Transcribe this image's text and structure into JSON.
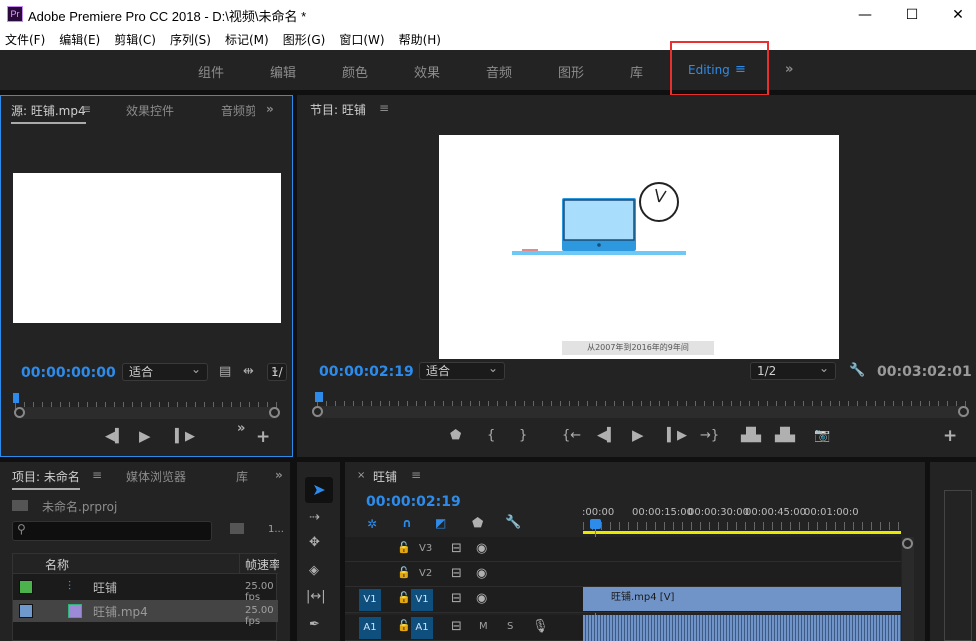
{
  "window": {
    "title": "Adobe Premiere Pro CC 2018 - D:\\视频\\未命名 *",
    "logo": "Pr",
    "minimize": "—",
    "maximize": "☐",
    "close": "✕"
  },
  "menu": [
    "文件(F)",
    "编辑(E)",
    "剪辑(C)",
    "序列(S)",
    "标记(M)",
    "图形(G)",
    "窗口(W)",
    "帮助(H)"
  ],
  "workspaces": {
    "items": [
      "组件",
      "编辑",
      "颜色",
      "效果",
      "音频",
      "图形",
      "库"
    ],
    "active": "Editing",
    "more": "»"
  },
  "source": {
    "tabs": [
      "源: 旺铺.mp4",
      "效果控件",
      "音频剪"
    ],
    "timecode": "00:00:00:00",
    "zoom": "适合",
    "resolution": "1/"
  },
  "program": {
    "tab": "节目: 旺铺",
    "timecode": "00:00:02:19",
    "zoom": "适合",
    "resolution": "1/2",
    "duration": "00:03:02:01",
    "caption": "从2007年到2016年的9年间"
  },
  "project": {
    "tabs": [
      "项目: 未命名",
      "媒体浏览器",
      "库"
    ],
    "file": "未命名.prproj",
    "count": "1...",
    "columns": [
      "名称",
      "帧速率"
    ],
    "items": [
      {
        "name": "旺铺",
        "fps": "25.00 fps",
        "color": "#4cb34c",
        "selected": false
      },
      {
        "name": "旺铺.mp4",
        "fps": "25.00 fps",
        "color": "#6f98cc",
        "selected": true
      }
    ]
  },
  "timeline": {
    "tab": "旺铺",
    "timecode": "00:00:02:19",
    "ruler": [
      ":00:00",
      "00:00:15:00",
      "00:00:30:00",
      "00:00:45:00",
      "00:01:00:0"
    ],
    "tracks": [
      {
        "id": "V3",
        "src": ""
      },
      {
        "id": "V2",
        "src": ""
      },
      {
        "id": "V1",
        "src": "V1",
        "clip": "旺铺.mp4 [V]"
      },
      {
        "id": "A1",
        "src": "A1",
        "m": "M",
        "s": "S"
      }
    ]
  },
  "colors": {
    "accent": "#2d8ceb",
    "workarea": "#e8e800",
    "clip": "#7094c8"
  }
}
